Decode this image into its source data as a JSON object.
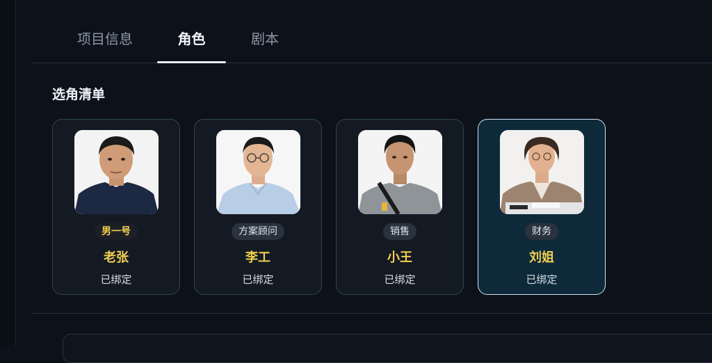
{
  "tabs": [
    {
      "label": "项目信息"
    },
    {
      "label": "角色"
    },
    {
      "label": "剧本"
    }
  ],
  "section": {
    "title": "选角清单"
  },
  "cards": [
    {
      "role": "男一号",
      "name": "老张",
      "status": "已绑定"
    },
    {
      "role": "方案顾问",
      "name": "李工",
      "status": "已绑定"
    },
    {
      "role": "销售",
      "name": "小王",
      "status": "已绑定"
    },
    {
      "role": "财务",
      "name": "刘姐",
      "status": "已绑定"
    }
  ],
  "colors": {
    "accent_gold": "#f2cf4f",
    "selected_card_bg": "#0e2a3a",
    "background": "#0c111a"
  }
}
